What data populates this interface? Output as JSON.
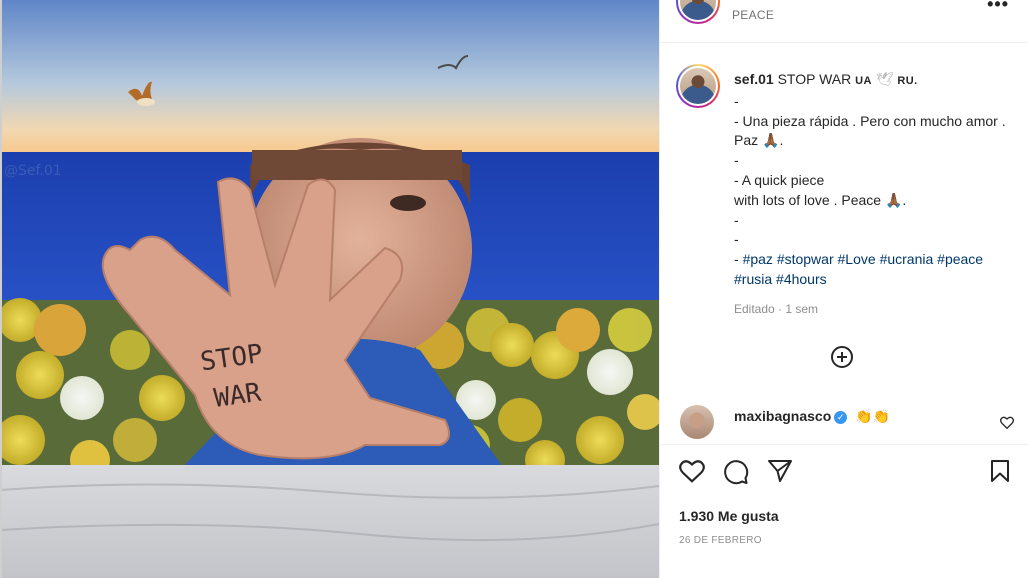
{
  "post": {
    "location": "PEACE",
    "image_signature": "@Sef.01",
    "wall_text_line1": "STOP",
    "wall_text_line2": "WAR"
  },
  "caption": {
    "username": "sef.01",
    "headline": "STOP WAR",
    "flag_ua": "UA",
    "dove": "🕊",
    "flag_ru": "RU.",
    "lines": [
      "-",
      "- Una pieza rápida . Pero con mucho amor . Paz 🙏🏾.",
      "-",
      "- A quick piece",
      "with lots of love . Peace 🙏🏾.",
      "-",
      "-",
      "- "
    ],
    "hashtags": [
      "#paz",
      "#stopwar",
      "#Love",
      "#ucrania",
      "#peace",
      "#rusia",
      "#4hours"
    ],
    "edit_info": "Editado · 1 sem"
  },
  "comment": {
    "username": "maxibagnasco",
    "verified_mark": "✓",
    "text": "👏👏"
  },
  "actions": {
    "likes": "1.930 Me gusta",
    "date": "26 DE FEBRERO"
  },
  "icons": {
    "more": "more-options-icon",
    "like": "heart-icon",
    "comment": "comment-icon",
    "share": "paper-plane-icon",
    "save": "bookmark-icon",
    "load_more": "plus-circle-icon"
  },
  "colors": {
    "hashtag": "#00376b",
    "verified": "#3897f0",
    "meta": "#8e8e8e"
  }
}
